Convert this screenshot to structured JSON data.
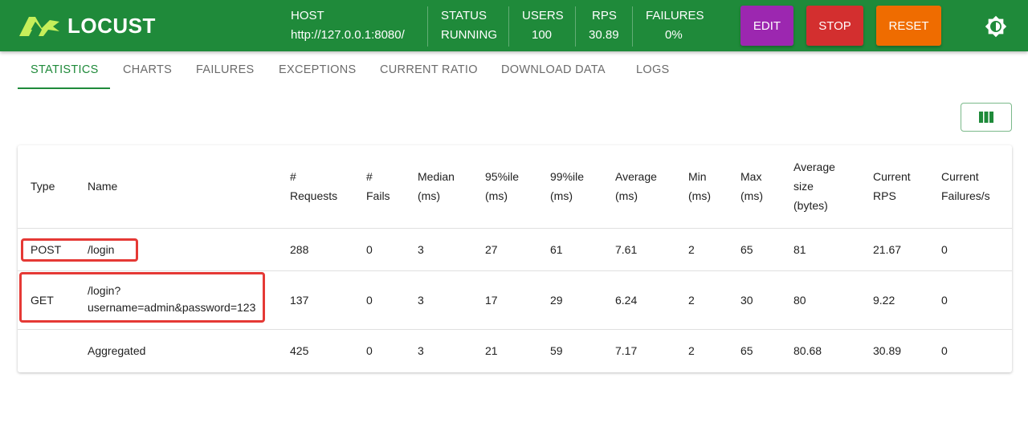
{
  "app": {
    "name": "LOCUST"
  },
  "header": {
    "host_label": "HOST",
    "host_value": "http://127.0.0.1:8080/",
    "status_label": "STATUS",
    "status_value": "RUNNING",
    "users_label": "USERS",
    "users_value": "100",
    "rps_label": "RPS",
    "rps_value": "30.89",
    "failures_label": "FAILURES",
    "failures_value": "0%",
    "edit_label": "EDIT",
    "stop_label": "STOP",
    "reset_label": "RESET",
    "theme_icon": "brightness-icon"
  },
  "tabs": [
    {
      "label": "STATISTICS",
      "active": true
    },
    {
      "label": "CHARTS"
    },
    {
      "label": "FAILURES"
    },
    {
      "label": "EXCEPTIONS"
    },
    {
      "label": "CURRENT RATIO"
    },
    {
      "label": "DOWNLOAD DATA"
    },
    {
      "label": "LOGS"
    }
  ],
  "toolbar": {
    "columns_icon": "view-column-icon"
  },
  "table": {
    "headers": {
      "type": [
        "Type"
      ],
      "name": [
        "Name"
      ],
      "requests": [
        "#",
        "Requests"
      ],
      "fails": [
        "#",
        "Fails"
      ],
      "median": [
        "Median",
        "(ms)"
      ],
      "p95": [
        "95%ile",
        "(ms)"
      ],
      "p99": [
        "99%ile",
        "(ms)"
      ],
      "average": [
        "Average",
        "(ms)"
      ],
      "min": [
        "Min",
        "(ms)"
      ],
      "max": [
        "Max",
        "(ms)"
      ],
      "avg_size": [
        "Average",
        "size",
        "(bytes)"
      ],
      "current_rps": [
        "Current",
        "RPS"
      ],
      "current_failures": [
        "Current",
        "Failures/s"
      ]
    },
    "rows": [
      {
        "type": "POST",
        "name": [
          "/login"
        ],
        "requests": "288",
        "fails": "0",
        "median": "3",
        "p95": "27",
        "p99": "61",
        "average": "7.61",
        "min": "2",
        "max": "65",
        "avg_size": "81",
        "current_rps": "21.67",
        "current_failures": "0"
      },
      {
        "type": "GET",
        "name": [
          "/login?",
          "username=admin&password=123"
        ],
        "requests": "137",
        "fails": "0",
        "median": "3",
        "p95": "17",
        "p99": "29",
        "average": "6.24",
        "min": "2",
        "max": "30",
        "avg_size": "80",
        "current_rps": "9.22",
        "current_failures": "0"
      },
      {
        "type": "",
        "name": [
          "Aggregated"
        ],
        "requests": "425",
        "fails": "0",
        "median": "3",
        "p95": "21",
        "p99": "59",
        "average": "7.17",
        "min": "2",
        "max": "65",
        "avg_size": "80.68",
        "current_rps": "30.89",
        "current_failures": "0"
      }
    ]
  },
  "colors": {
    "brand": "#1f8a3a",
    "edit": "#9c27b0",
    "stop": "#d32f2f",
    "reset": "#ef6c00",
    "highlight": "#e53935"
  }
}
